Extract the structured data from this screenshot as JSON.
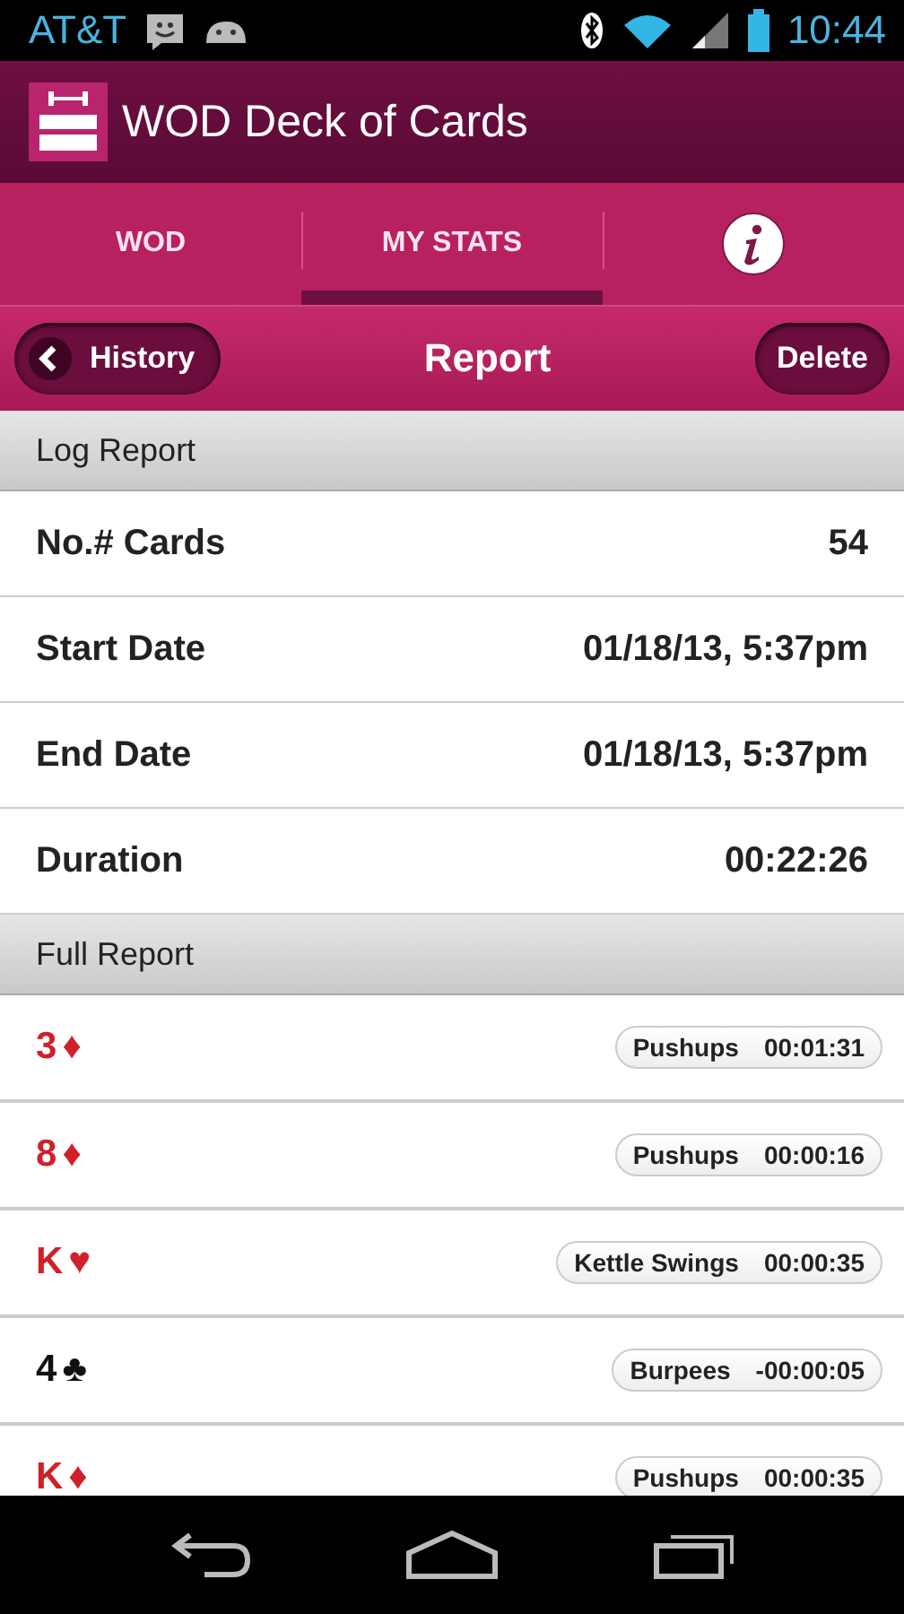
{
  "status_bar": {
    "carrier": "AT&T",
    "time": "10:44"
  },
  "app_bar": {
    "title": "WOD Deck of Cards"
  },
  "tabs": [
    {
      "kind": "text",
      "label": "WOD",
      "selected": false
    },
    {
      "kind": "text",
      "label": "MY STATS",
      "selected": true
    },
    {
      "kind": "info",
      "selected": false
    }
  ],
  "toolbar": {
    "back_button": "History",
    "title": "Report",
    "action_button": "Delete"
  },
  "log_report": {
    "header": "Log Report",
    "rows": [
      {
        "label": "No.# Cards",
        "value": "54"
      },
      {
        "label": "Start Date",
        "value": "01/18/13, 5:37pm"
      },
      {
        "label": "End Date",
        "value": "01/18/13, 5:37pm"
      },
      {
        "label": "Duration",
        "value": "00:22:26"
      }
    ]
  },
  "full_report": {
    "header": "Full Report",
    "cards": [
      {
        "rank": "3",
        "suit": "♦",
        "color": "#d0202a",
        "exercise": "Pushups",
        "time": "00:01:31"
      },
      {
        "rank": "8",
        "suit": "♦",
        "color": "#d0202a",
        "exercise": "Pushups",
        "time": "00:00:16"
      },
      {
        "rank": "K",
        "suit": "♥",
        "color": "#d0202a",
        "exercise": "Kettle Swings",
        "time": "00:00:35"
      },
      {
        "rank": "4",
        "suit": "♣",
        "color": "#111111",
        "exercise": "Burpees",
        "time": "-00:00:05"
      },
      {
        "rank": "K",
        "suit": "♦",
        "color": "#d0202a",
        "exercise": "Pushups",
        "time": "00:00:35"
      }
    ]
  }
}
